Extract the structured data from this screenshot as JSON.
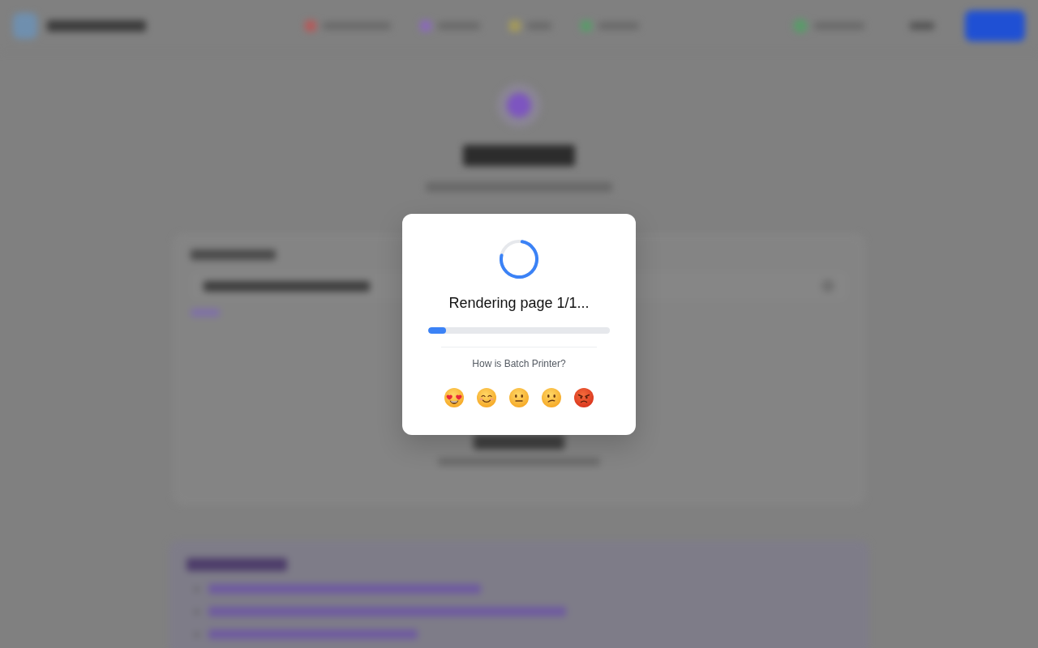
{
  "dialog": {
    "status": "Rendering page 1/1...",
    "progress": {
      "level": 0.1
    },
    "feedback": {
      "question": "How is Batch Printer?",
      "options": [
        {
          "kind": "heart-eyes"
        },
        {
          "kind": "smiling"
        },
        {
          "kind": "neutral"
        },
        {
          "kind": "confused"
        },
        {
          "kind": "angry"
        }
      ]
    }
  }
}
